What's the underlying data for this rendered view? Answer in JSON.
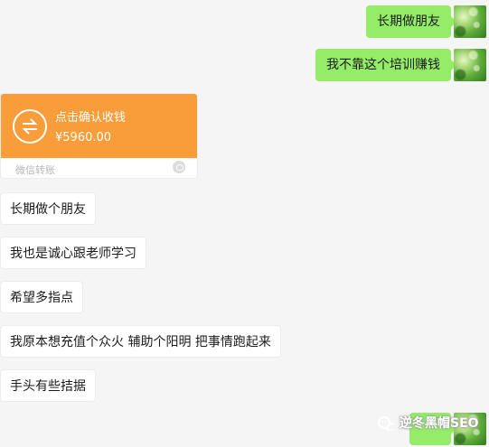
{
  "messages_out": [
    {
      "text": "长期做朋友"
    },
    {
      "text": "我不靠这个培训赚钱"
    },
    {
      "text": ""
    }
  ],
  "transfer": {
    "title": "点击确认收钱",
    "amount": "¥5960.00",
    "footer": "微信转账",
    "icon": "transfer-arrows-icon"
  },
  "messages_in": [
    {
      "text": "长期做个朋友"
    },
    {
      "text": "我也是诚心跟老师学习"
    },
    {
      "text": "希望多指点"
    },
    {
      "text": "我原本想充值个众火 辅助个阳明 把事情跑起来"
    },
    {
      "text": "手头有些拮据"
    }
  ],
  "watermark": {
    "text": "逆冬黑帽SEO",
    "icon": "wechat-official-account-icon"
  },
  "colors": {
    "bubble_out": "#95ec69",
    "bubble_in": "#ffffff",
    "transfer_orange": "#f89d3a",
    "background": "#f5f5f5"
  }
}
